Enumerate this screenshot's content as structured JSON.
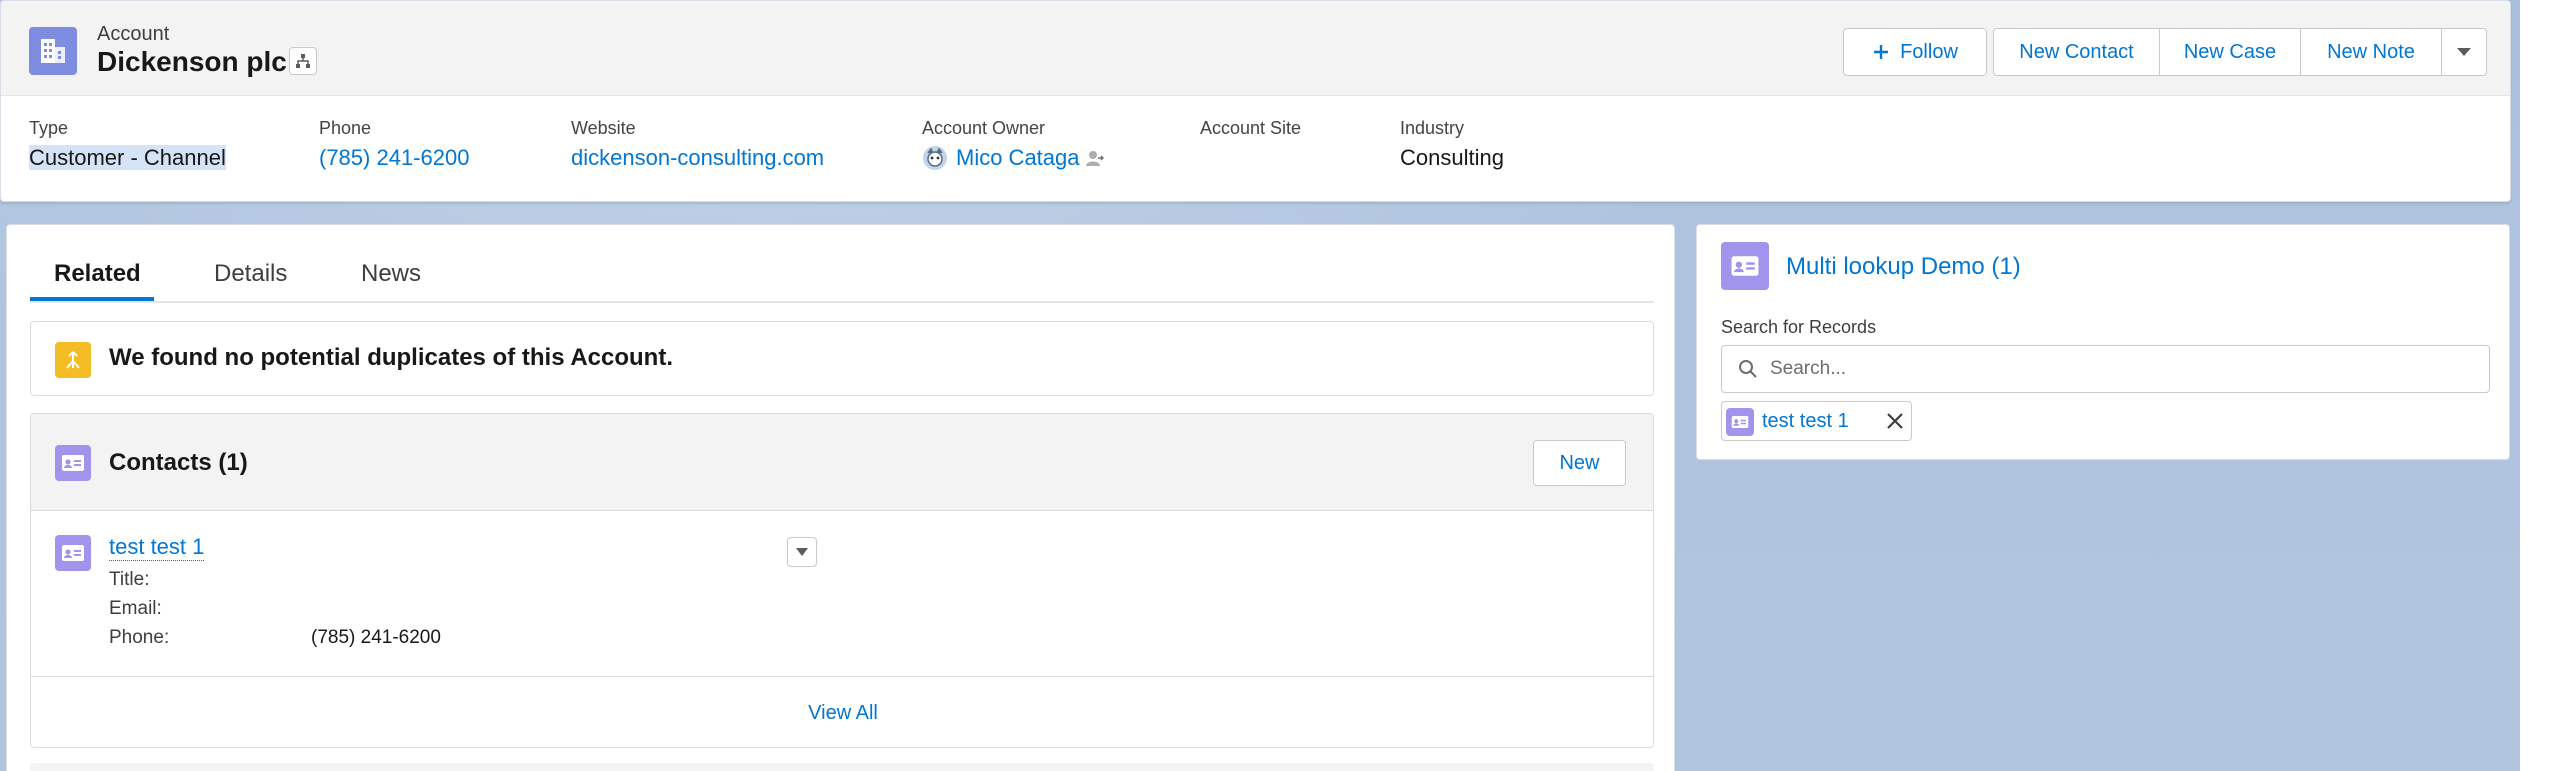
{
  "header": {
    "object_type": "Account",
    "record_name": "Dickenson plc",
    "actions": {
      "follow": "Follow",
      "new_contact": "New Contact",
      "new_case": "New Case",
      "new_note": "New Note"
    },
    "fields": [
      {
        "label": "Type",
        "value": "Customer - Channel"
      },
      {
        "label": "Phone",
        "value": "(785) 241-6200"
      },
      {
        "label": "Website",
        "value": "dickenson-consulting.com"
      },
      {
        "label": "Account Owner",
        "value": "Mico Cataga"
      },
      {
        "label": "Account Site",
        "value": ""
      },
      {
        "label": "Industry",
        "value": "Consulting"
      }
    ]
  },
  "tabs": [
    {
      "label": "Related",
      "active": true
    },
    {
      "label": "Details",
      "active": false
    },
    {
      "label": "News",
      "active": false
    }
  ],
  "duplicates": {
    "message": "We found no potential duplicates of this Account."
  },
  "contacts": {
    "title": "Contacts (1)",
    "new_label": "New",
    "items": [
      {
        "name": "test test 1",
        "title_label": "Title:",
        "title_value": "",
        "email_label": "Email:",
        "email_value": "",
        "phone_label": "Phone:",
        "phone_value": "(785) 241-6200"
      }
    ],
    "view_all": "View All"
  },
  "lookup": {
    "title": "Multi lookup Demo (1)",
    "search_label": "Search for Records",
    "search_placeholder": "Search...",
    "selected": [
      {
        "label": "test test 1"
      }
    ]
  },
  "colors": {
    "brand_link": "#0176d3",
    "account_icon": "#7f8de1",
    "contact_icon": "#a094ed",
    "duplicate_icon": "#f4bc25",
    "background": "#b0c4df"
  }
}
